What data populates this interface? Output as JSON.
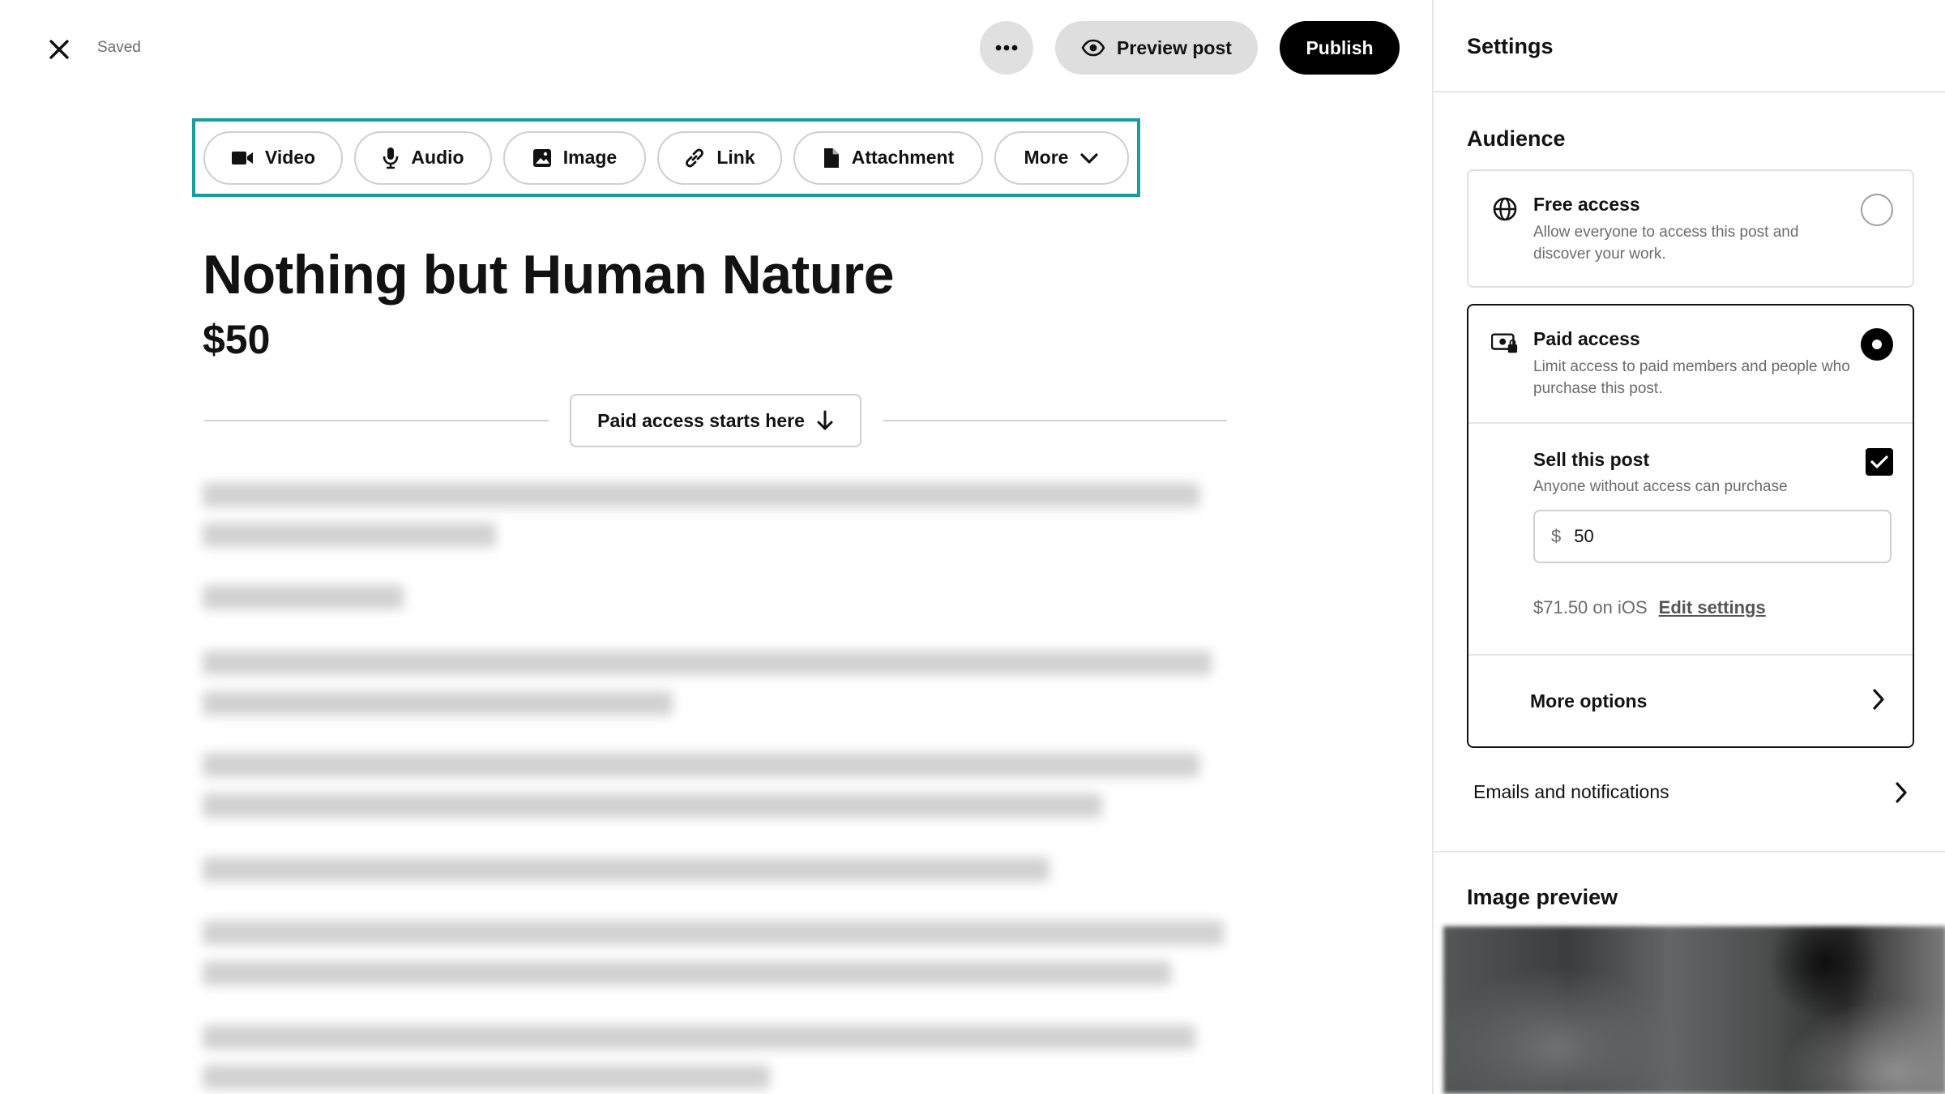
{
  "topbar": {
    "saved_label": "Saved",
    "preview_label": "Preview post",
    "publish_label": "Publish"
  },
  "toolbar": {
    "items": [
      {
        "label": "Video",
        "icon": "video-icon"
      },
      {
        "label": "Audio",
        "icon": "microphone-icon"
      },
      {
        "label": "Image",
        "icon": "image-icon"
      },
      {
        "label": "Link",
        "icon": "link-icon"
      },
      {
        "label": "Attachment",
        "icon": "file-icon"
      },
      {
        "label": "More",
        "icon": "chevron-down-icon"
      }
    ],
    "highlight_color": "#1c9b9b"
  },
  "post": {
    "title": "Nothing but Human Nature",
    "price": "$50",
    "paid_divider_label": "Paid access starts here"
  },
  "settings": {
    "title": "Settings",
    "audience_title": "Audience",
    "free_access": {
      "title": "Free access",
      "description": "Allow everyone to access this post and discover your work.",
      "selected": false
    },
    "paid_access": {
      "title": "Paid access",
      "description": "Limit access to paid members and people who purchase this post.",
      "selected": true
    },
    "sell_post": {
      "title": "Sell this post",
      "description": "Anyone without access can purchase",
      "checked": true,
      "currency_symbol": "$",
      "price_value": "50",
      "ios_price": "$71.50 on iOS",
      "edit_link": "Edit settings"
    },
    "more_options_label": "More options",
    "emails_label": "Emails and notifications",
    "image_preview_title": "Image preview"
  }
}
